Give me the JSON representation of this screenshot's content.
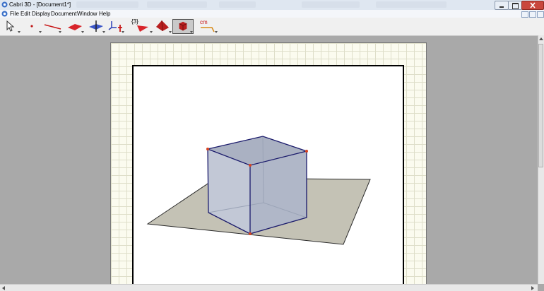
{
  "window": {
    "title": "Cabri 3D - [Document1*]"
  },
  "menu": {
    "items": [
      "File",
      "Edit",
      "Display",
      "Document",
      "Window",
      "Help"
    ]
  },
  "toolbar": {
    "tools": [
      {
        "name": "pointer-tool",
        "icon": "arrow-pointer-icon"
      },
      {
        "name": "point-tool",
        "icon": "point-icon"
      },
      {
        "name": "line-tool",
        "icon": "line-icon"
      },
      {
        "name": "plane-tool",
        "icon": "plane-icon"
      },
      {
        "name": "perpendicular-tool",
        "icon": "perpendicular-plane-icon"
      },
      {
        "name": "transformation-tool",
        "icon": "axes-icon"
      },
      {
        "name": "polygon-tool",
        "icon": "triangle-icon"
      },
      {
        "name": "polyhedron-tool",
        "icon": "pyramid-icon"
      },
      {
        "name": "regular-polyhedron-tool",
        "icon": "cube-icon",
        "selected": true
      },
      {
        "name": "measurement-tool",
        "icon": "measure-icon"
      }
    ],
    "set_label": "{3}",
    "measure_label": "cm"
  },
  "colors": {
    "cube_fill": "#b9c0cf",
    "cube_edge": "#1a1a6b",
    "plane_fill": "#c4c2b5",
    "vertex": "#d9431e",
    "grid_bg": "#fbfbef",
    "workspace": "#a9a9a9"
  }
}
